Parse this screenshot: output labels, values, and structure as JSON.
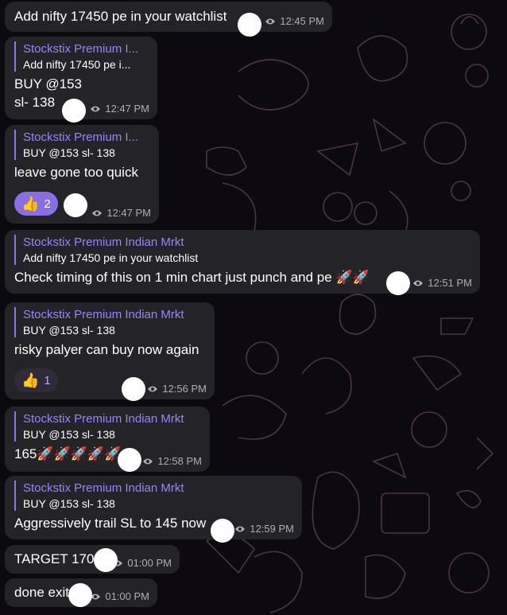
{
  "messages": [
    {
      "text": "Add nifty 17450 pe in your watchlist",
      "time": "12:45 PM"
    },
    {
      "reply_title": "Stockstix Premium I...",
      "reply_text": "Add nifty 17450 pe i...",
      "text_line1": "BUY @153",
      "text_line2": "sl- 138",
      "time": "12:47 PM"
    },
    {
      "reply_title": "Stockstix Premium I...",
      "reply_text": "BUY @153 sl- 138",
      "text": "leave gone too quick",
      "reaction": {
        "icon": "thumbs-up",
        "emoji": "👍",
        "count": "2"
      },
      "time": "12:47 PM"
    },
    {
      "reply_title": "Stockstix Premium Indian Mrkt",
      "reply_text": "Add nifty 17450 pe in your watchlist",
      "text": "Check timing of this on 1 min chart just punch and pe 🚀🚀",
      "time": "12:51 PM"
    },
    {
      "reply_title": "Stockstix Premium Indian Mrkt",
      "reply_text": "BUY @153 sl- 138",
      "text": "risky palyer can buy now again",
      "reaction": {
        "icon": "thumbs-up",
        "emoji": "👍",
        "count": "1"
      },
      "time": "12:56 PM"
    },
    {
      "reply_title": "Stockstix Premium Indian Mrkt",
      "reply_text": "BUY @153 sl- 138",
      "text": "165🚀🚀🚀🚀🚀",
      "time": "12:58 PM"
    },
    {
      "reply_title": "Stockstix Premium Indian Mrkt",
      "reply_text": "BUY @153 sl- 138",
      "text": "Aggressively trail SL to 145 now",
      "time": "12:59 PM"
    },
    {
      "text": "TARGET 170",
      "time": "01:00 PM"
    },
    {
      "text": "done exit",
      "time": "01:00 PM"
    }
  ],
  "icons": {
    "views": "eye-icon",
    "reaction": "thumbs-up"
  },
  "colors": {
    "bubble": "#242328",
    "accent": "#9a86f4",
    "reaction_active": "#8a6ee3",
    "meta": "#aeaeb5"
  }
}
